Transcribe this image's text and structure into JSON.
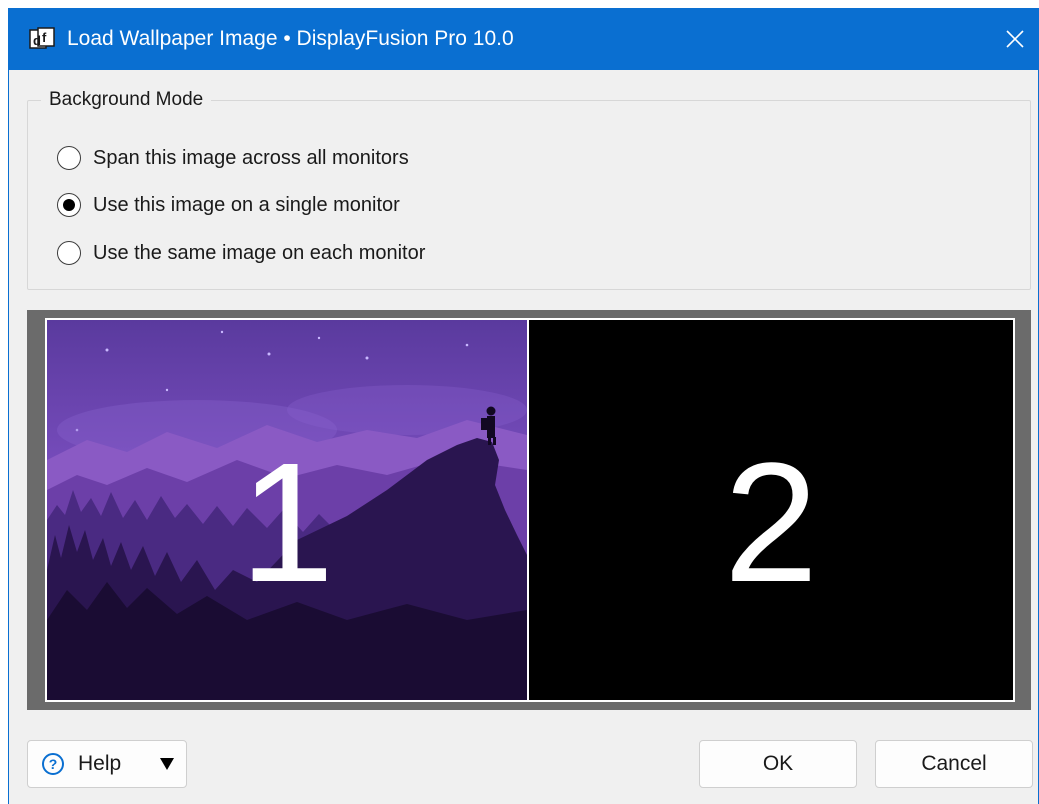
{
  "window": {
    "title": "Load Wallpaper Image • DisplayFusion Pro 10.0",
    "app_icon": "displayfusion-icon",
    "close_icon": "close-icon"
  },
  "background_mode": {
    "legend": "Background Mode",
    "options": [
      {
        "label": "Span this image across all monitors",
        "checked": false
      },
      {
        "label": "Use this image on a single monitor",
        "checked": true
      },
      {
        "label": "Use the same image on each monitor",
        "checked": false
      }
    ]
  },
  "preview": {
    "monitors": [
      {
        "number": "1",
        "wallpaper": "purple-mountain-night-landscape"
      },
      {
        "number": "2",
        "wallpaper": "none"
      }
    ]
  },
  "buttons": {
    "help_label": "Help",
    "help_icon": "question-circle-icon",
    "help_dropdown_icon": "triangle-down-icon",
    "ok_label": "OK",
    "cancel_label": "Cancel"
  },
  "colors": {
    "titlebar": "#0a6fd1",
    "dialog_bg": "#f0f0f0",
    "preview_bg": "#6b6b6b"
  }
}
